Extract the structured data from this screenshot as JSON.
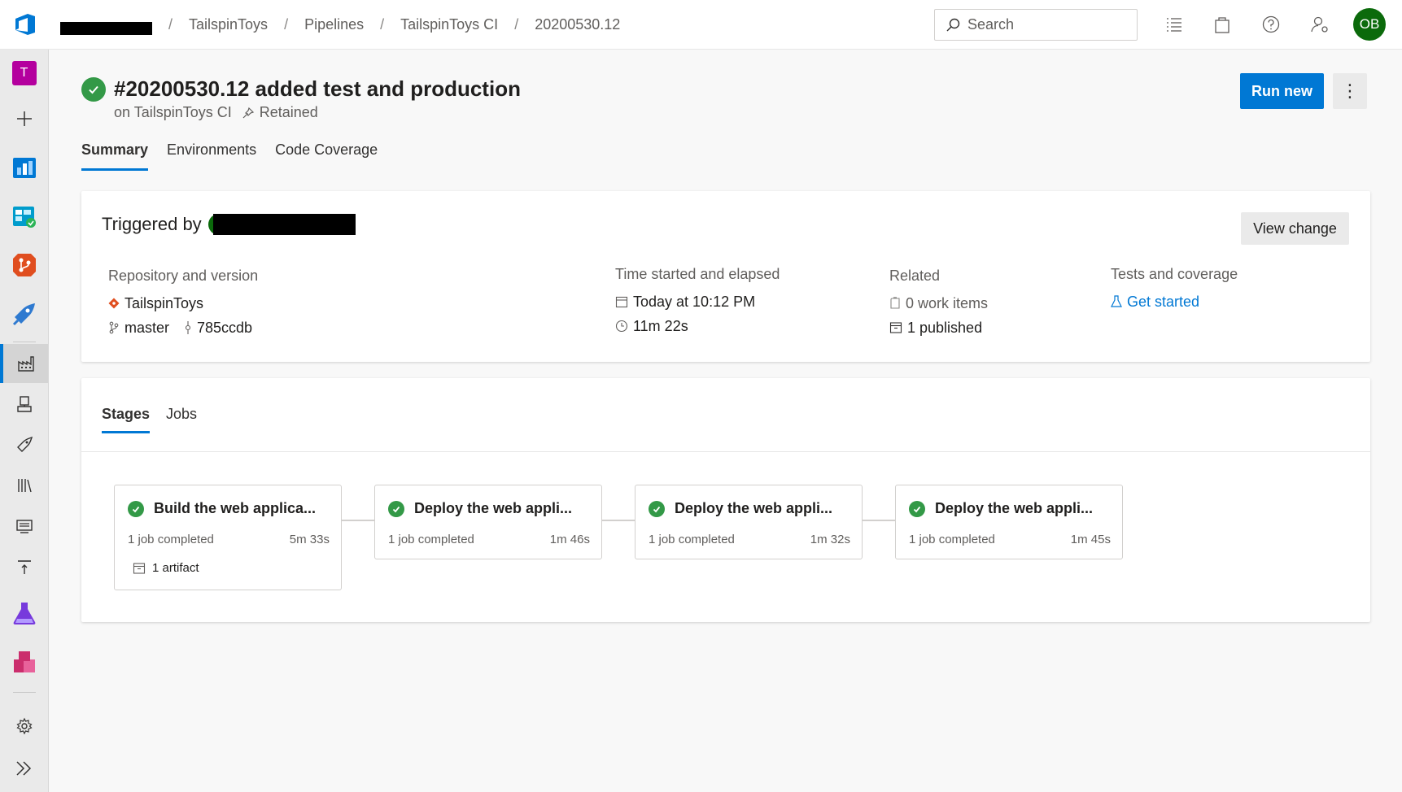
{
  "breadcrumb": {
    "items": [
      "TailspinToys",
      "Pipelines",
      "TailspinToys CI",
      "20200530.12"
    ],
    "separator": "/"
  },
  "search": {
    "placeholder": "Search"
  },
  "user": {
    "initials": "OB"
  },
  "rail": {
    "project_initial": "T"
  },
  "run": {
    "title": "#20200530.12 added test and production",
    "pipeline": "on TailspinToys CI",
    "retained": "Retained",
    "run_new_label": "Run new",
    "more_label": "⋮"
  },
  "tabs": [
    "Summary",
    "Environments",
    "Code Coverage"
  ],
  "summary": {
    "triggered_by": "Triggered by",
    "view_change_label": "View change",
    "repo": {
      "label": "Repository and version",
      "name": "TailspinToys",
      "branch": "master",
      "commit": "785ccdb"
    },
    "time": {
      "label": "Time started and elapsed",
      "started": "Today at 10:12 PM",
      "elapsed": "11m 22s"
    },
    "related": {
      "label": "Related",
      "work_items": "0 work items",
      "published": "1 published"
    },
    "tests": {
      "label": "Tests and coverage",
      "link": "Get started"
    }
  },
  "stage_tabs": [
    "Stages",
    "Jobs"
  ],
  "stages": [
    {
      "name": "Build the web applica...",
      "jobs": "1 job completed",
      "duration": "5m 33s",
      "artifact": "1 artifact"
    },
    {
      "name": "Deploy the web appli...",
      "jobs": "1 job completed",
      "duration": "1m 46s"
    },
    {
      "name": "Deploy the web appli...",
      "jobs": "1 job completed",
      "duration": "1m 32s"
    },
    {
      "name": "Deploy the web appli...",
      "jobs": "1 job completed",
      "duration": "1m 45s"
    }
  ],
  "colors": {
    "accent": "#0078d4",
    "success": "#339947",
    "avatar": "#0b6a0b",
    "project": "#b4009e"
  }
}
